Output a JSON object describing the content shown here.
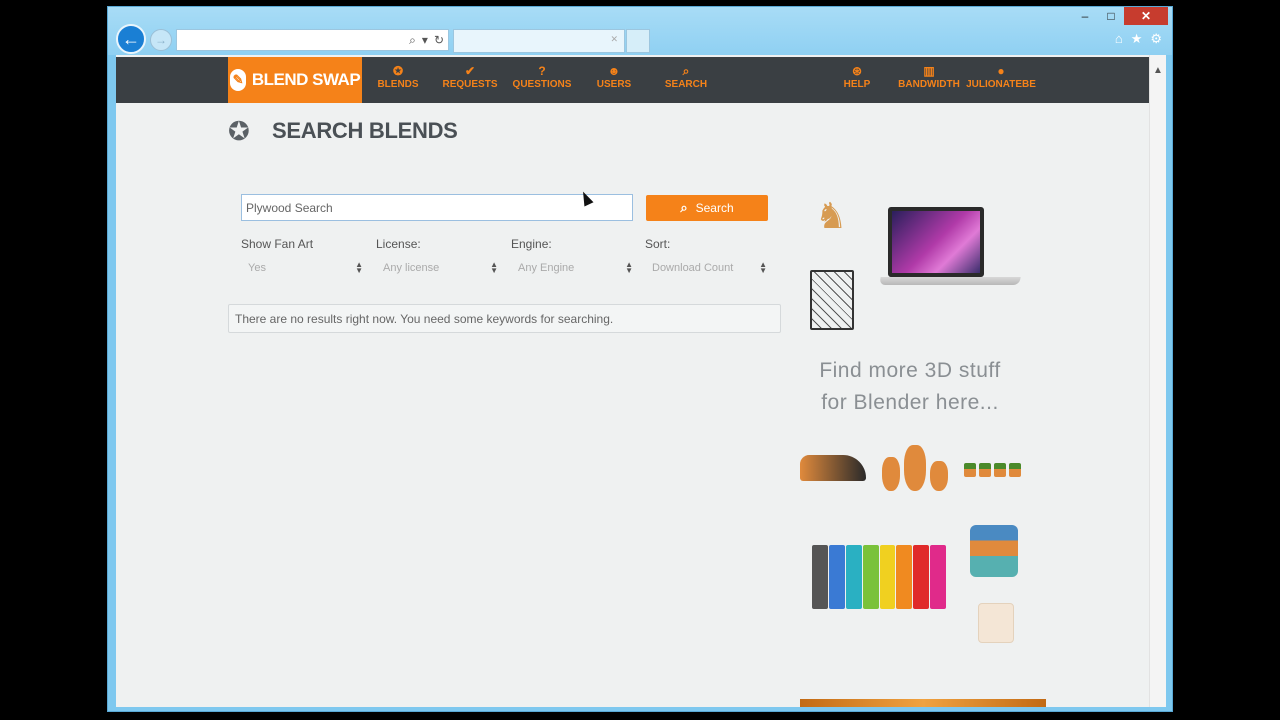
{
  "browser": {
    "window_controls": {
      "minimize": "–",
      "maximize": "□",
      "close": "✕"
    },
    "back_icon": "arrow-left-icon",
    "forward_icon": "arrow-right-icon",
    "address_value": "",
    "tab_title": "",
    "tools": [
      "home-icon",
      "star-icon",
      "gear-icon"
    ]
  },
  "navbar": {
    "logo_text": "BLEND SWAP",
    "left_items": [
      {
        "label": "BLENDS",
        "icon": "blender-icon"
      },
      {
        "label": "REQUESTS",
        "icon": "check-icon"
      },
      {
        "label": "QUESTIONS",
        "icon": "question-icon"
      },
      {
        "label": "USERS",
        "icon": "users-icon"
      },
      {
        "label": "SEARCH",
        "icon": "search-icon"
      }
    ],
    "right_items": [
      {
        "label": "HELP",
        "icon": "lifebuoy-icon"
      },
      {
        "label": "BANDWIDTH",
        "icon": "bar-chart-icon"
      },
      {
        "label": "JULIONATEBE",
        "icon": "user-icon"
      }
    ],
    "colors": {
      "bar": "#3a3f43",
      "accent": "#f58219"
    }
  },
  "page": {
    "title": "SEARCH BLENDS",
    "search": {
      "value": "Plywood Search",
      "button_label": "Search"
    },
    "filters": [
      {
        "label": "Show Fan Art",
        "selected": "Yes"
      },
      {
        "label": "License:",
        "selected": "Any license"
      },
      {
        "label": "Engine:",
        "selected": "Any Engine"
      },
      {
        "label": "Sort:",
        "selected": "Download Count"
      }
    ],
    "no_results": "There are no results right now. You need some keywords for searching."
  },
  "ad": {
    "line1": "Find more 3D stuff",
    "line2": "for Blender here..."
  }
}
